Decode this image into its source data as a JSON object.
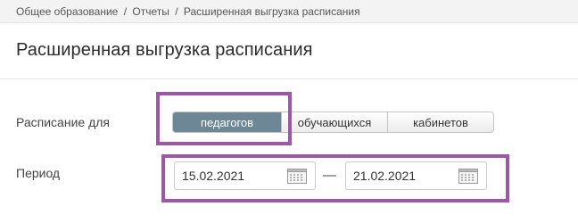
{
  "breadcrumb": {
    "items": [
      "Общее образование",
      "Отчеты",
      "Расширенная выгрузка расписания"
    ],
    "separator": "/"
  },
  "page": {
    "title": "Расширенная выгрузка расписания"
  },
  "schedule_for": {
    "label": "Расписание для",
    "options": [
      "педагогов",
      "обучающихся",
      "кабинетов"
    ],
    "selected": "педагогов"
  },
  "period": {
    "label": "Период",
    "from": "15.02.2021",
    "to": "21.02.2021",
    "dash": "—"
  },
  "colors": {
    "active_segment": "#6d8796",
    "highlight_frame": "#9c57a6",
    "breadcrumb_bg": "#f3f3f3"
  },
  "icons": {
    "calendar": "calendar-icon"
  }
}
